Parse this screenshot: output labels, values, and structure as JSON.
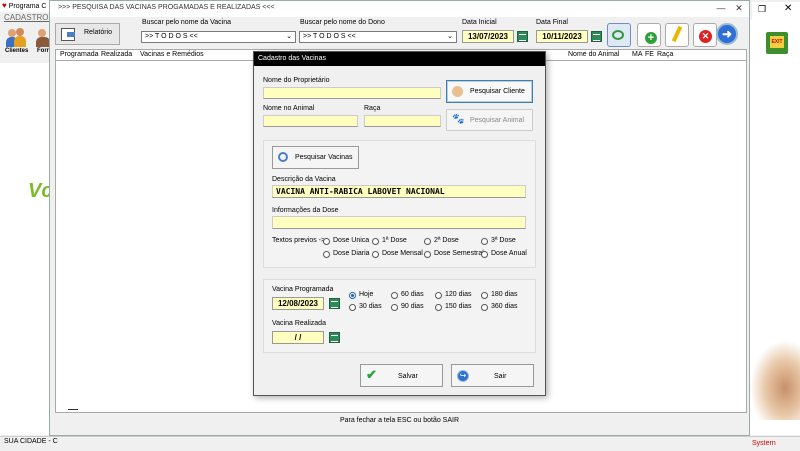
{
  "background_app": {
    "title": "Programa C",
    "menu": "CADASTROS",
    "toolbar": [
      {
        "label": "Clientes"
      },
      {
        "label": "Forr"
      }
    ],
    "logo_fragment": "Vc",
    "status_left": "SUA CIDADE - C",
    "status_right": "Systern"
  },
  "main_window": {
    "title": ">>>  PESQUISA DAS VACINAS PROGAMADAS E REALIZADAS  <<<",
    "relatorio_label": "Relatório",
    "search_vaccine_label": "Buscar pelo nome da Vacina",
    "search_vaccine_value": ">> T O D O S <<",
    "search_owner_label": "Buscar pelo nome do Dono",
    "search_owner_value": ">> T O D O S <<",
    "date_start_label": "Data Inicial",
    "date_start_value": "13/07/2023",
    "date_end_label": "Data Final",
    "date_end_value": "10/11/2023",
    "columns": [
      "Programada",
      "Realizada",
      "Vacinas e Remédios",
      "Nome do Animal",
      "MA",
      "FE",
      "Raça"
    ],
    "footer": "Para fechar a tela ESC ou botão SAIR"
  },
  "dialog": {
    "title": "Cadastro das Vacinas",
    "owner_label": "Nome do Proprietário",
    "owner_value": "",
    "pesquisar_cliente": "Pesquisar Cliente",
    "animal_label": "Nome no Animal",
    "animal_value": "",
    "raca_label": "Raça",
    "raca_value": "",
    "pesquisar_animal": "Pesquisar Animal",
    "pesquisar_vacinas": "Pesquisar Vacinas",
    "vaccine_desc_label": "Descrição da Vacina",
    "vaccine_desc_value": "VACINA ANTI-RABICA LABOVET NACIONAL",
    "dose_info_label": "Informações da Dose",
    "dose_info_value": "",
    "textos_label": "Textos previos ->",
    "dose_options": [
      "Dose Unica",
      "1ª Dose",
      "2ª Dose",
      "3ª Dose",
      "Dose Diaria",
      "Dose Mensal",
      "Dose Semestral",
      "Dose Anual"
    ],
    "programada_label": "Vacina Programada",
    "programada_value": "12/08/2023",
    "realizada_label": "Vacina Realizada",
    "realizada_value": " /  / ",
    "periods": [
      "Hoje",
      "60 dias",
      "120 dias",
      "180 dias",
      "30 dias",
      "90 dias",
      "150 dias",
      "360 dias"
    ],
    "period_selected": "Hoje",
    "salvar": "Salvar",
    "sair": "Sair"
  }
}
